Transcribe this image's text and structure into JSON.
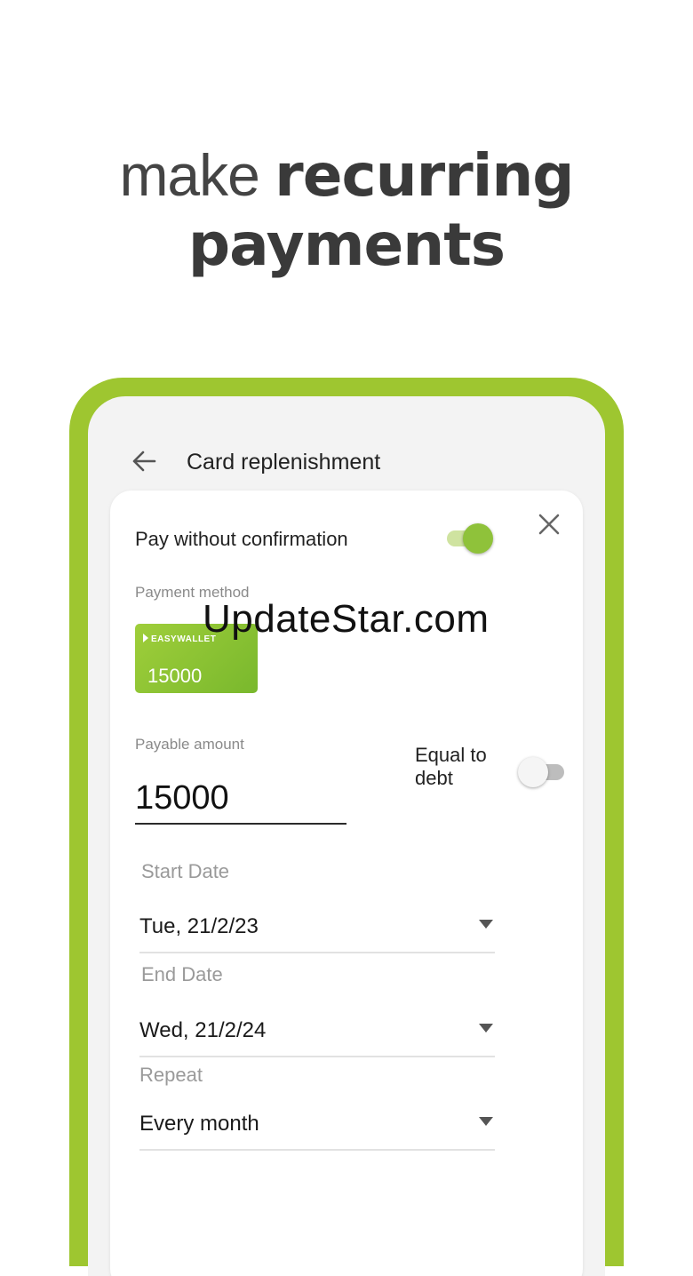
{
  "headline": {
    "light": "make ",
    "bold1": "recurring",
    "bold2": "payments"
  },
  "screen": {
    "title": "Card replenishment"
  },
  "form": {
    "pay_without_confirmation_label": "Pay without confirmation",
    "pay_without_confirmation_on": true,
    "payment_method_label": "Payment method",
    "wallet_brand": "EASYWALLET",
    "wallet_balance": "15000",
    "payable_amount_label": "Payable amount",
    "payable_amount_value": "15000",
    "equal_to_debt_label": "Equal to debt",
    "equal_to_debt_on": false,
    "start_date_label": "Start Date",
    "start_date_value": "Tue, 21/2/23",
    "end_date_label": "End Date",
    "end_date_value": "Wed, 21/2/24",
    "repeat_label": "Repeat",
    "repeat_value": "Every month"
  },
  "watermark": "UpdateStar.com",
  "colors": {
    "brand_green": "#9ec630",
    "toggle_on": "#8fc23a",
    "text_dark": "#222222",
    "label_gray": "#8a8a8a"
  },
  "icons": {
    "back": "arrow-left-icon",
    "close": "close-icon",
    "caret": "chevron-down-icon"
  }
}
